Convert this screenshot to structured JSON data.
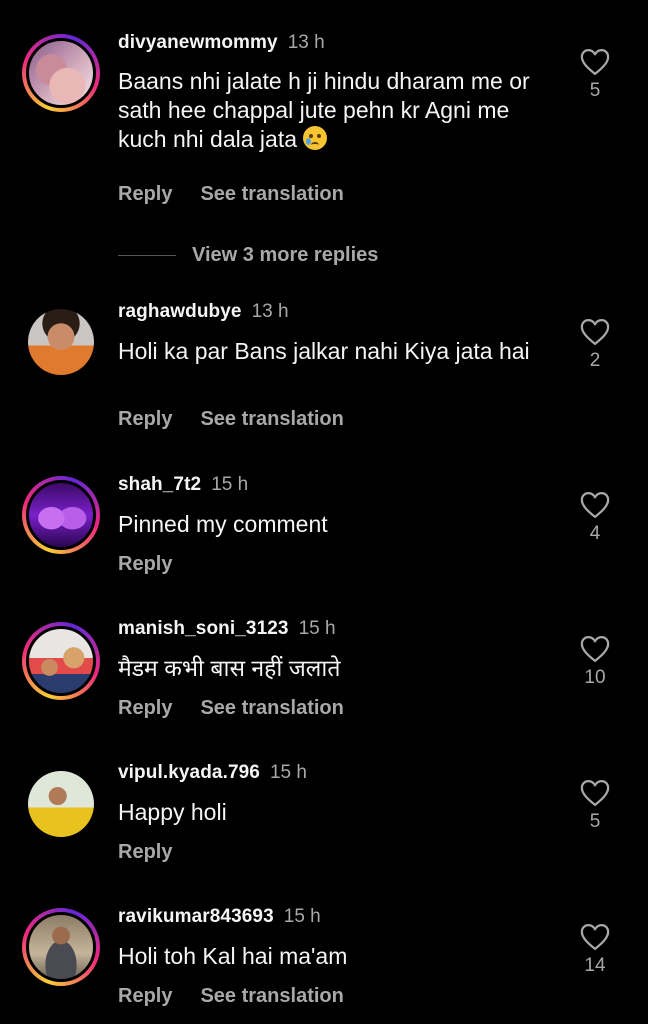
{
  "comments": [
    {
      "username": "divyanewmommy",
      "time": "13 h",
      "text": "Baans nhi jalate h ji hindu dharam me or sath hee chappal jute pehn kr Agni me kuch nhi dala jata",
      "emoji": "crying-face",
      "likes": "5",
      "reply_label": "Reply",
      "translate_label": "See translation",
      "view_more": "View 3 more replies"
    },
    {
      "username": "raghawdubye",
      "time": "13 h",
      "text": "Holi ka par Bans jalkar nahi Kiya jata hai",
      "likes": "2",
      "reply_label": "Reply",
      "translate_label": "See translation"
    },
    {
      "username": "shah_7t2",
      "time": "15 h",
      "text": "Pinned my comment",
      "likes": "4",
      "reply_label": "Reply"
    },
    {
      "username": "manish_soni_3123",
      "time": "15 h",
      "text": "मैडम कभी बास नहीं जलाते",
      "likes": "10",
      "reply_label": "Reply",
      "translate_label": "See translation"
    },
    {
      "username": "vipul.kyada.796",
      "time": "15 h",
      "text": "Happy holi",
      "likes": "5",
      "reply_label": "Reply"
    },
    {
      "username": "ravikumar843693",
      "time": "15 h",
      "text": "Holi toh Kal hai ma'am",
      "likes": "14",
      "reply_label": "Reply",
      "translate_label": "See translation"
    }
  ],
  "icons": {
    "like": "heart-outline-icon"
  },
  "colors": {
    "background": "#000000",
    "text": "#f5f5f5",
    "secondary": "#a8a8a8",
    "story_ring": "#ee2a7b"
  }
}
